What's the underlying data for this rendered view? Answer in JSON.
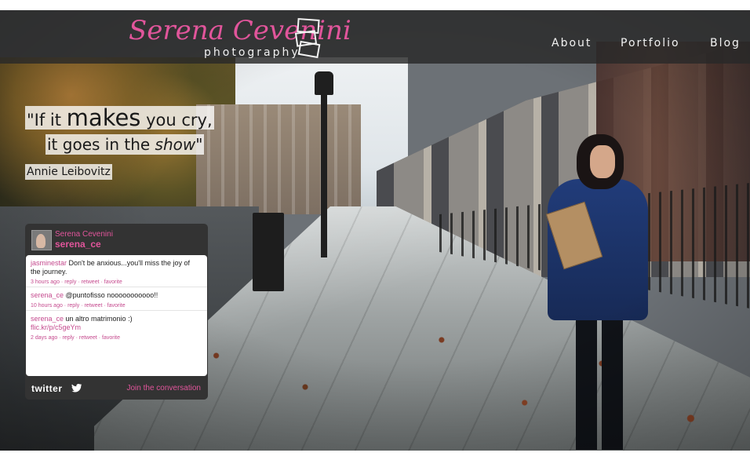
{
  "header": {
    "brand_name": "Serena Cevenini",
    "brand_sub": "photography",
    "nav": [
      "About",
      "Portfolio",
      "Blog"
    ]
  },
  "quote": {
    "part1": "\"If it ",
    "emph": "makes",
    "part2": " you cry,",
    "part3": "it goes in the ",
    "italic": "show",
    "part4": "\"",
    "author": "Annie Leibovitz"
  },
  "twitter": {
    "display_name": "Serena Cevenini",
    "handle": "serena_ce",
    "tweets": [
      {
        "user": "jasminestar",
        "text": " Don't be anxious...you'll miss the joy of the journey.",
        "link": "",
        "meta": "3 hours ago · reply · retweet · favorite"
      },
      {
        "user": "serena_ce",
        "text": " @puntofisso nooooooooooo!!",
        "link": "",
        "meta": "10 hours ago · reply · retweet · favorite"
      },
      {
        "user": "serena_ce",
        "text": " un altro matrimonio :)",
        "link": "flic.kr/p/c5geYm",
        "meta": "2 days ago · reply · retweet · favorite"
      }
    ],
    "logo_text": "twitter",
    "join_label": "Join the conversation"
  },
  "colors": {
    "accent_pink": "#e1559b",
    "header_bg": "#282828",
    "widget_bg": "#333333"
  }
}
